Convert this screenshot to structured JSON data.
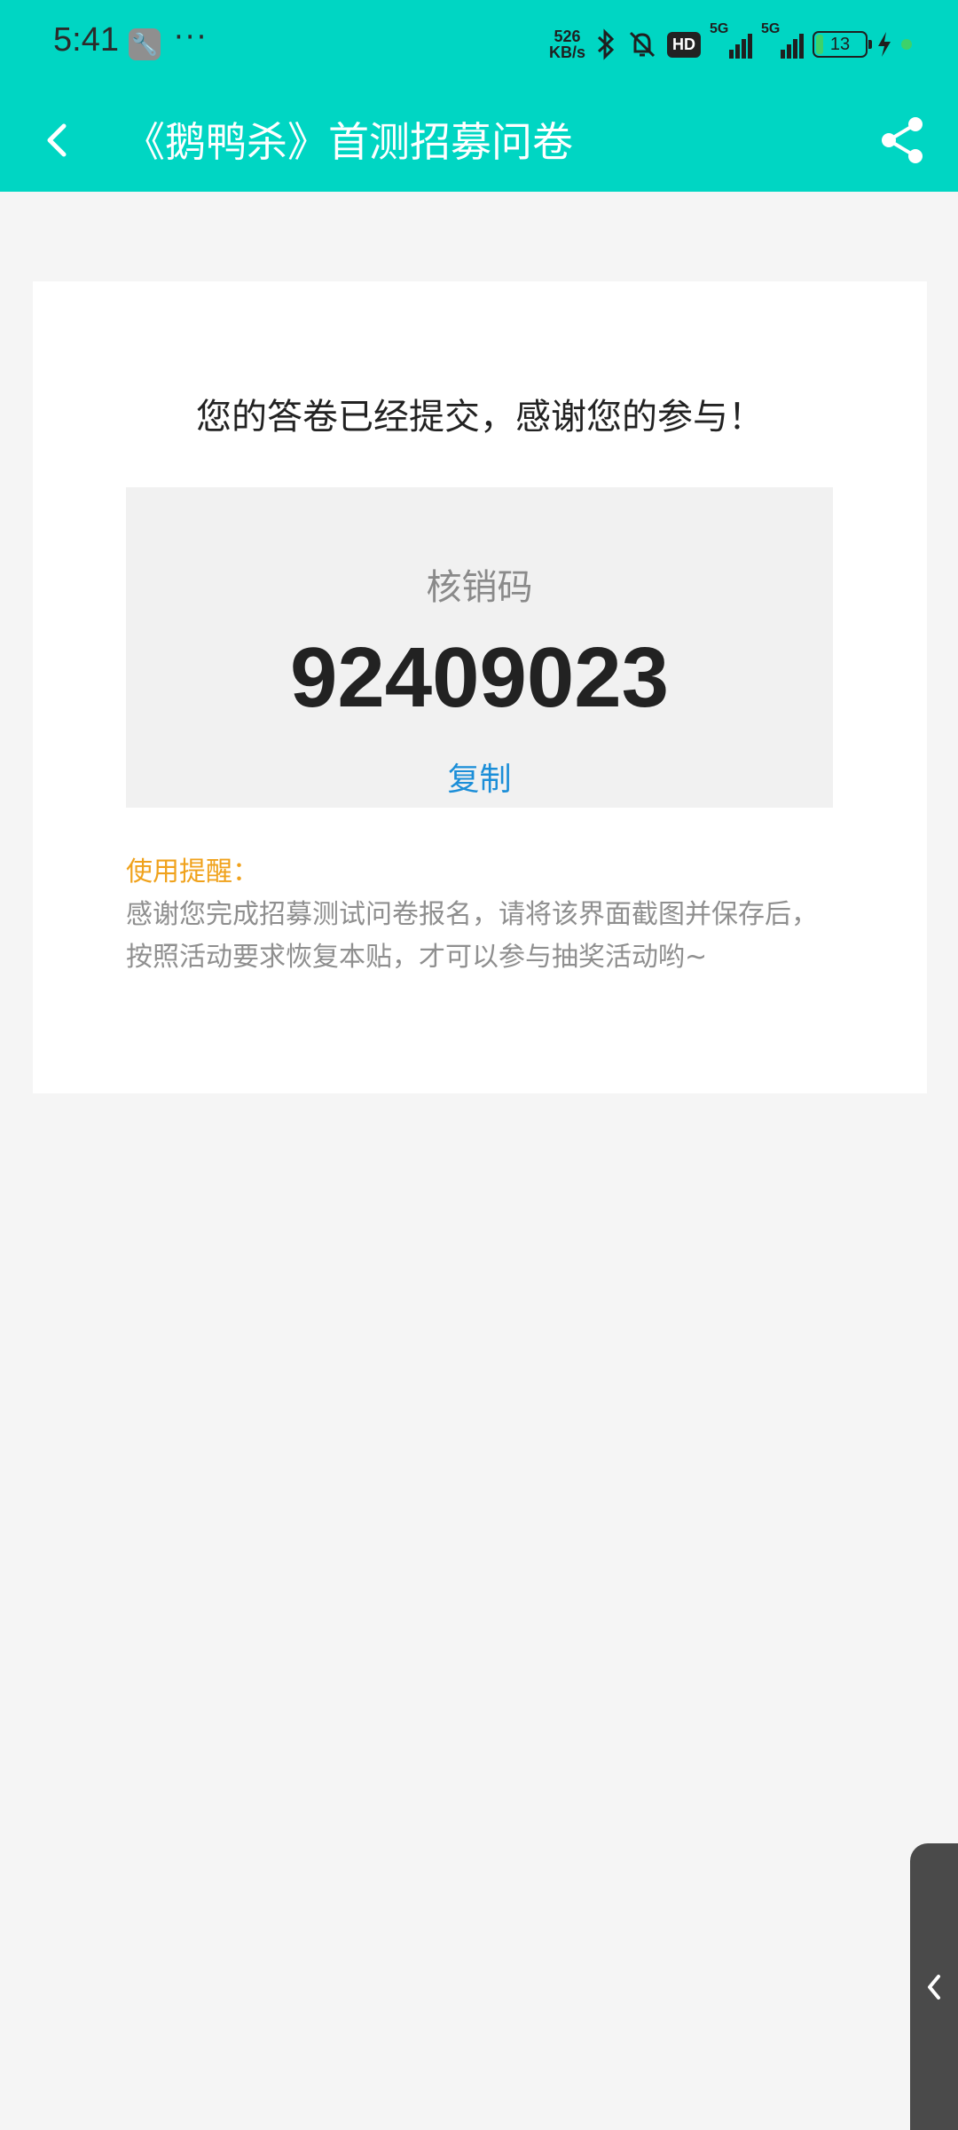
{
  "status_bar": {
    "time": "5:41",
    "more": "···",
    "net_speed_value": "526",
    "net_speed_unit": "KB/s",
    "hd_badge": "HD",
    "sim1": "5G",
    "sim2": "5G",
    "battery_level": "13"
  },
  "header": {
    "title": "《鹅鸭杀》首测招募问卷",
    "background_color": "#00d6c3"
  },
  "card": {
    "thanks_message": "您的答卷已经提交，感谢您的参与！",
    "code_label": "核销码",
    "code_value": "92409023",
    "copy_label": "复制",
    "reminder_title": "使用提醒：",
    "reminder_text": "感谢您完成招募测试问卷报名，请将该界面截图并保存后，按照活动要求恢复本贴，才可以参与抽奖活动哟~"
  },
  "colors": {
    "accent": "#00d6c3",
    "link": "#1b8ed8",
    "reminder": "#f0a21c"
  },
  "icons": [
    "back-arrow-icon",
    "share-icon",
    "wrench-icon",
    "bluetooth-icon",
    "mute-bell-icon",
    "signal-icon",
    "battery-icon",
    "charging-icon",
    "chevron-left-icon"
  ]
}
